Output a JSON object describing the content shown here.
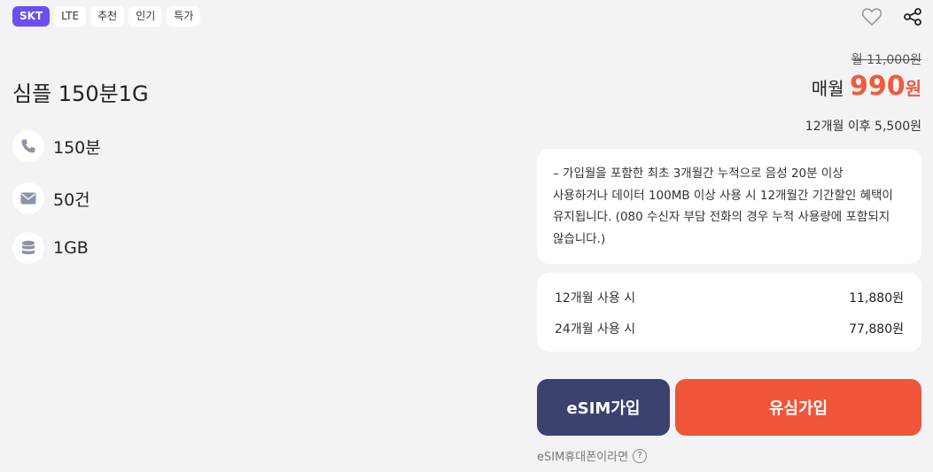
{
  "tags": [
    "SKT",
    "LTE",
    "추천",
    "인기",
    "특가"
  ],
  "icons": {
    "favorite": "heart-icon",
    "share": "share-icon",
    "call": "phone-icon",
    "sms": "mail-icon",
    "data": "database-icon",
    "help": "question-icon"
  },
  "colors": {
    "accent": "#6c4ff0",
    "price": "#f05a3d",
    "esim_button": "#3c4270",
    "usim_button": "#f0553a"
  },
  "plan": {
    "name": "심플 150분1G"
  },
  "features": [
    {
      "icon": "phone-icon",
      "text": "150분"
    },
    {
      "icon": "mail-icon",
      "text": "50건"
    },
    {
      "icon": "database-icon",
      "text": "1GB"
    }
  ],
  "pricing": {
    "original": "월 11,000원",
    "monthly_prefix": "매월",
    "monthly_value": "990",
    "monthly_unit": "원",
    "after": "12개월 이후 5,500원"
  },
  "notice": {
    "line1": "– 가입월을 포함한 최초 3개월간 누적으로 음성 20분 이상",
    "line2": "사용하거나 데이터 100MB 이상 사용 시 12개월간 기간할인 혜택이",
    "line3": "유지됩니다. (080 수신자 부담 전화의 경우 누적 사용량에 포함되지",
    "line4": "않습니다.)"
  },
  "costs": [
    {
      "label": "12개월 사용 시",
      "amount": "11,880원"
    },
    {
      "label": "24개월 사용 시",
      "amount": "77,880원"
    }
  ],
  "buttons": {
    "esim": "eSIM가입",
    "usim": "유심가입"
  },
  "esim_help": {
    "label": "eSIM휴대폰이라면",
    "icon_text": "?"
  }
}
